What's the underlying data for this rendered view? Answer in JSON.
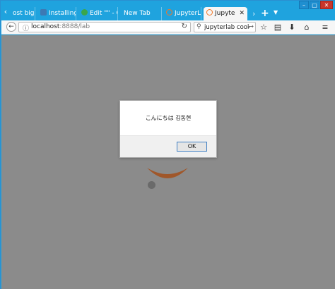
{
  "browser": {
    "tabs": [
      {
        "label": "ost bigo",
        "favicon": "none",
        "active": false
      },
      {
        "label": "Installing",
        "favicon": "python-icon",
        "active": false
      },
      {
        "label": "Edit \"\" - C",
        "favicon": "chrome-icon",
        "active": false
      },
      {
        "label": "New Tab",
        "favicon": "none",
        "active": false
      },
      {
        "label": "JupyterLa",
        "favicon": "jupyter-icon",
        "active": false
      },
      {
        "label": "Jupyte",
        "favicon": "jupyter-icon",
        "active": true
      }
    ],
    "url_host": "localhost",
    "url_path": ":8888/lab",
    "search_value": "jupyterlab cookiec"
  },
  "dialog": {
    "message": "こんにちは 김동현",
    "ok_label": "OK"
  },
  "colors": {
    "titlebar": "#1fa3de",
    "page_overlay": "#8b8b8b",
    "jupyter_orange": "#f37726",
    "close_button": "#c9352a"
  }
}
